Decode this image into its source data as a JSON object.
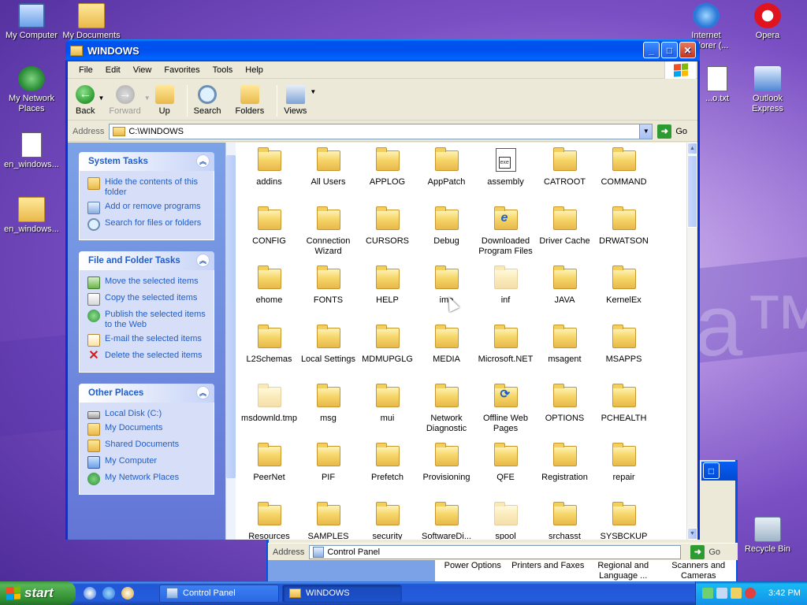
{
  "desktop": {
    "icons": {
      "my_computer": "My Computer",
      "my_documents": "My Documents",
      "my_network_places": "My Network Places",
      "file1": "en_windows...",
      "file2": "en_windows...",
      "internet_explorer": "Internet Explorer (...",
      "opera": "Opera",
      "txt_file": "...o.txt",
      "outlook": "Outlook Express",
      "recycle_bin": "Recycle Bin"
    },
    "wallpaper_text": "na™"
  },
  "window": {
    "title": "WINDOWS",
    "menu": [
      "File",
      "Edit",
      "View",
      "Favorites",
      "Tools",
      "Help"
    ],
    "toolbar": {
      "back": "Back",
      "forward": "Forward",
      "up": "Up",
      "search": "Search",
      "folders": "Folders",
      "views": "Views"
    },
    "address": {
      "label": "Address",
      "value": "C:\\WINDOWS",
      "go": "Go"
    },
    "system_tasks": {
      "title": "System Tasks",
      "items": [
        "Hide the contents of this folder",
        "Add or remove programs",
        "Search for files or folders"
      ]
    },
    "file_folder_tasks": {
      "title": "File and Folder Tasks",
      "items": [
        "Move the selected items",
        "Copy the selected items",
        "Publish the selected items to the Web",
        "E-mail the selected items",
        "Delete the selected items"
      ]
    },
    "other_places": {
      "title": "Other Places",
      "items": [
        "Local Disk (C:)",
        "My Documents",
        "Shared Documents",
        "My Computer",
        "My Network Places"
      ]
    },
    "files": [
      {
        "name": "addins",
        "type": "folder"
      },
      {
        "name": "All Users",
        "type": "folder"
      },
      {
        "name": "APPLOG",
        "type": "folder"
      },
      {
        "name": "AppPatch",
        "type": "folder"
      },
      {
        "name": "assembly",
        "type": "file"
      },
      {
        "name": "CATROOT",
        "type": "folder"
      },
      {
        "name": "COMMAND",
        "type": "folder"
      },
      {
        "name": "CONFIG",
        "type": "folder"
      },
      {
        "name": "Connection Wizard",
        "type": "folder"
      },
      {
        "name": "CURSORS",
        "type": "folder"
      },
      {
        "name": "Debug",
        "type": "folder"
      },
      {
        "name": "Downloaded Program Files",
        "type": "ie-folder"
      },
      {
        "name": "Driver Cache",
        "type": "folder"
      },
      {
        "name": "DRWATSON",
        "type": "folder"
      },
      {
        "name": "ehome",
        "type": "folder"
      },
      {
        "name": "FONTS",
        "type": "folder"
      },
      {
        "name": "HELP",
        "type": "folder"
      },
      {
        "name": "ime",
        "type": "folder"
      },
      {
        "name": "inf",
        "type": "ghost-folder"
      },
      {
        "name": "JAVA",
        "type": "folder"
      },
      {
        "name": "KernelEx",
        "type": "folder"
      },
      {
        "name": "L2Schemas",
        "type": "folder"
      },
      {
        "name": "Local Settings",
        "type": "folder"
      },
      {
        "name": "MDMUPGLG",
        "type": "folder"
      },
      {
        "name": "MEDIA",
        "type": "folder"
      },
      {
        "name": "Microsoft.NET",
        "type": "folder"
      },
      {
        "name": "msagent",
        "type": "folder"
      },
      {
        "name": "MSAPPS",
        "type": "folder"
      },
      {
        "name": "msdownld.tmp",
        "type": "ghost-folder"
      },
      {
        "name": "msg",
        "type": "folder"
      },
      {
        "name": "mui",
        "type": "folder"
      },
      {
        "name": "Network Diagnostic",
        "type": "folder"
      },
      {
        "name": "Offline Web Pages",
        "type": "sync-folder"
      },
      {
        "name": "OPTIONS",
        "type": "folder"
      },
      {
        "name": "PCHEALTH",
        "type": "folder"
      },
      {
        "name": "PeerNet",
        "type": "folder"
      },
      {
        "name": "PIF",
        "type": "folder"
      },
      {
        "name": "Prefetch",
        "type": "folder"
      },
      {
        "name": "Provisioning",
        "type": "folder"
      },
      {
        "name": "QFE",
        "type": "folder"
      },
      {
        "name": "Registration",
        "type": "folder"
      },
      {
        "name": "repair",
        "type": "folder"
      },
      {
        "name": "Resources",
        "type": "folder"
      },
      {
        "name": "SAMPLES",
        "type": "folder"
      },
      {
        "name": "security",
        "type": "folder"
      },
      {
        "name": "SoftwareDi...",
        "type": "folder"
      },
      {
        "name": "spool",
        "type": "ghost-folder"
      },
      {
        "name": "srchasst",
        "type": "folder"
      },
      {
        "name": "SYSBCKUP",
        "type": "folder"
      }
    ]
  },
  "control_panel_window": {
    "address_label": "Address",
    "address_value": "Control Panel",
    "go": "Go",
    "items": [
      "Power Options",
      "Printers and Faxes",
      "Regional and Language ...",
      "Scanners and Cameras"
    ]
  },
  "taskbar": {
    "start": "start",
    "tasks": [
      "Control Panel",
      "WINDOWS"
    ],
    "clock": "3:42 PM"
  }
}
